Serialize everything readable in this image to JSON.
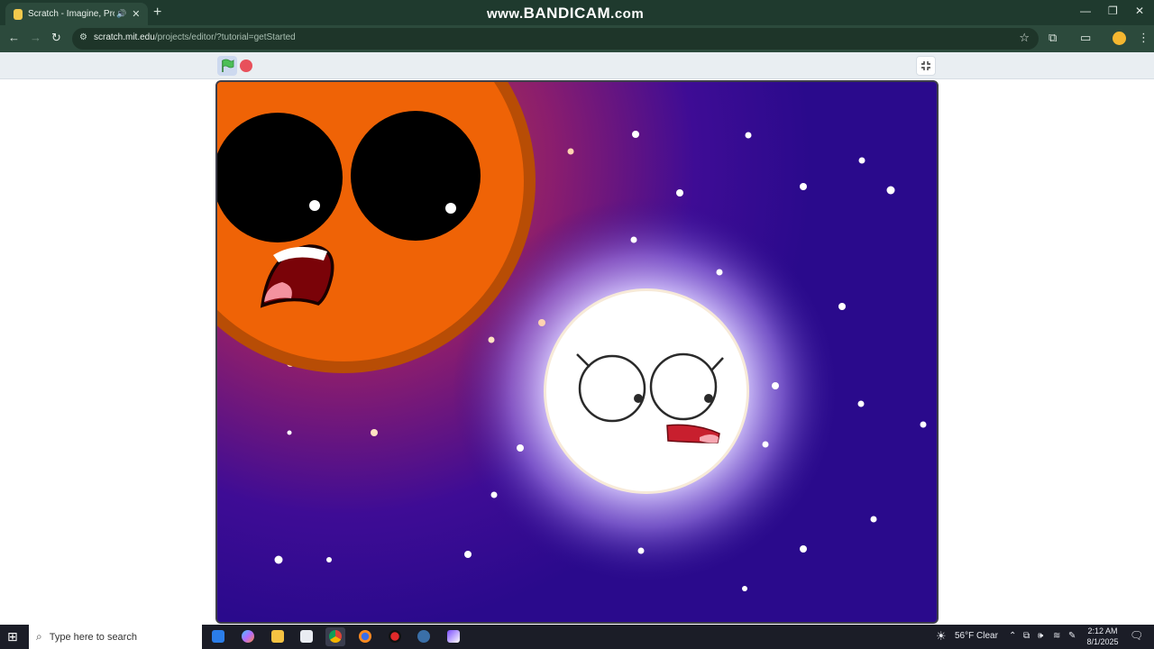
{
  "browser": {
    "tab_title": "Scratch - Imagine, Program",
    "tab_audio_icon": "speaker-icon",
    "tab_close": "✕",
    "new_tab": "+",
    "url_host": "scratch.mit.edu",
    "url_path": "/projects/editor/?tutorial=getStarted",
    "watermark_prefix": "www.",
    "watermark_brand": "BANDICAM",
    "watermark_suffix": ".com",
    "window_controls": [
      "—",
      "❐",
      "✕"
    ]
  },
  "scratch": {
    "green_flag_icon": "green-flag-icon",
    "stop_icon": "stop-icon",
    "fullscreen_icon": "fullscreen-exit-icon"
  },
  "stage": {
    "scene": "space-background",
    "characters": [
      "orange-sun-character",
      "white-moon-character"
    ],
    "colors": {
      "space": "#2a0a8c",
      "sun": "#ef6306",
      "sun_rim": "#b84d05",
      "moon": "#ffffff",
      "moon_glow": "#c5b6ff"
    }
  },
  "taskbar": {
    "search_placeholder": "Type here to search",
    "weather": "56°F  Clear",
    "time": "2:12 AM",
    "date": "8/1/2025",
    "apps": [
      "mail-icon",
      "copilot-icon",
      "file-explorer-icon",
      "store-icon",
      "chrome-icon",
      "firefox-icon",
      "bandicam-icon",
      "steam-icon",
      "sketch-app-icon"
    ]
  }
}
